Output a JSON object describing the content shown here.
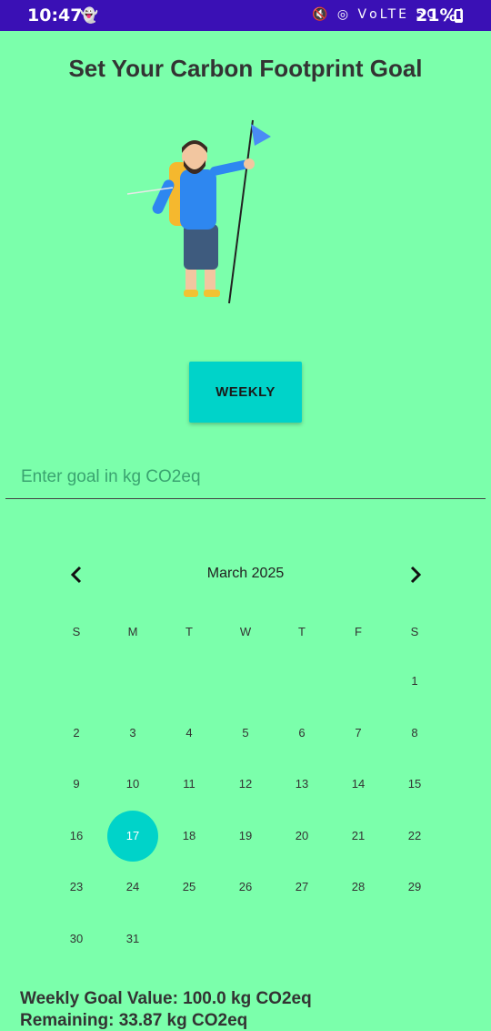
{
  "status_bar": {
    "time": "10:47",
    "icons": "🔇 ◎ ⅤoLTE 5G .ıl",
    "battery_text": "21%",
    "battery_level": 0.21
  },
  "page": {
    "title": "Set Your Carbon Footprint Goal"
  },
  "controls": {
    "period_label": "WEEKLY",
    "goal_placeholder": "Enter goal in kg CO2eq",
    "goal_value": ""
  },
  "calendar": {
    "month_label": "March 2025",
    "weekdays": [
      "S",
      "M",
      "T",
      "W",
      "T",
      "F",
      "S"
    ],
    "first_weekday": 6,
    "days_in_month": 31,
    "selected_day": 17
  },
  "summary": {
    "weekly_goal": "Weekly Goal Value: 100.0 kg CO2eq",
    "remaining": "Remaining: 33.87 kg CO2eq"
  },
  "colors": {
    "background": "#7bffab",
    "accent": "#00d3c9",
    "status_bar": "#3a10b5"
  }
}
